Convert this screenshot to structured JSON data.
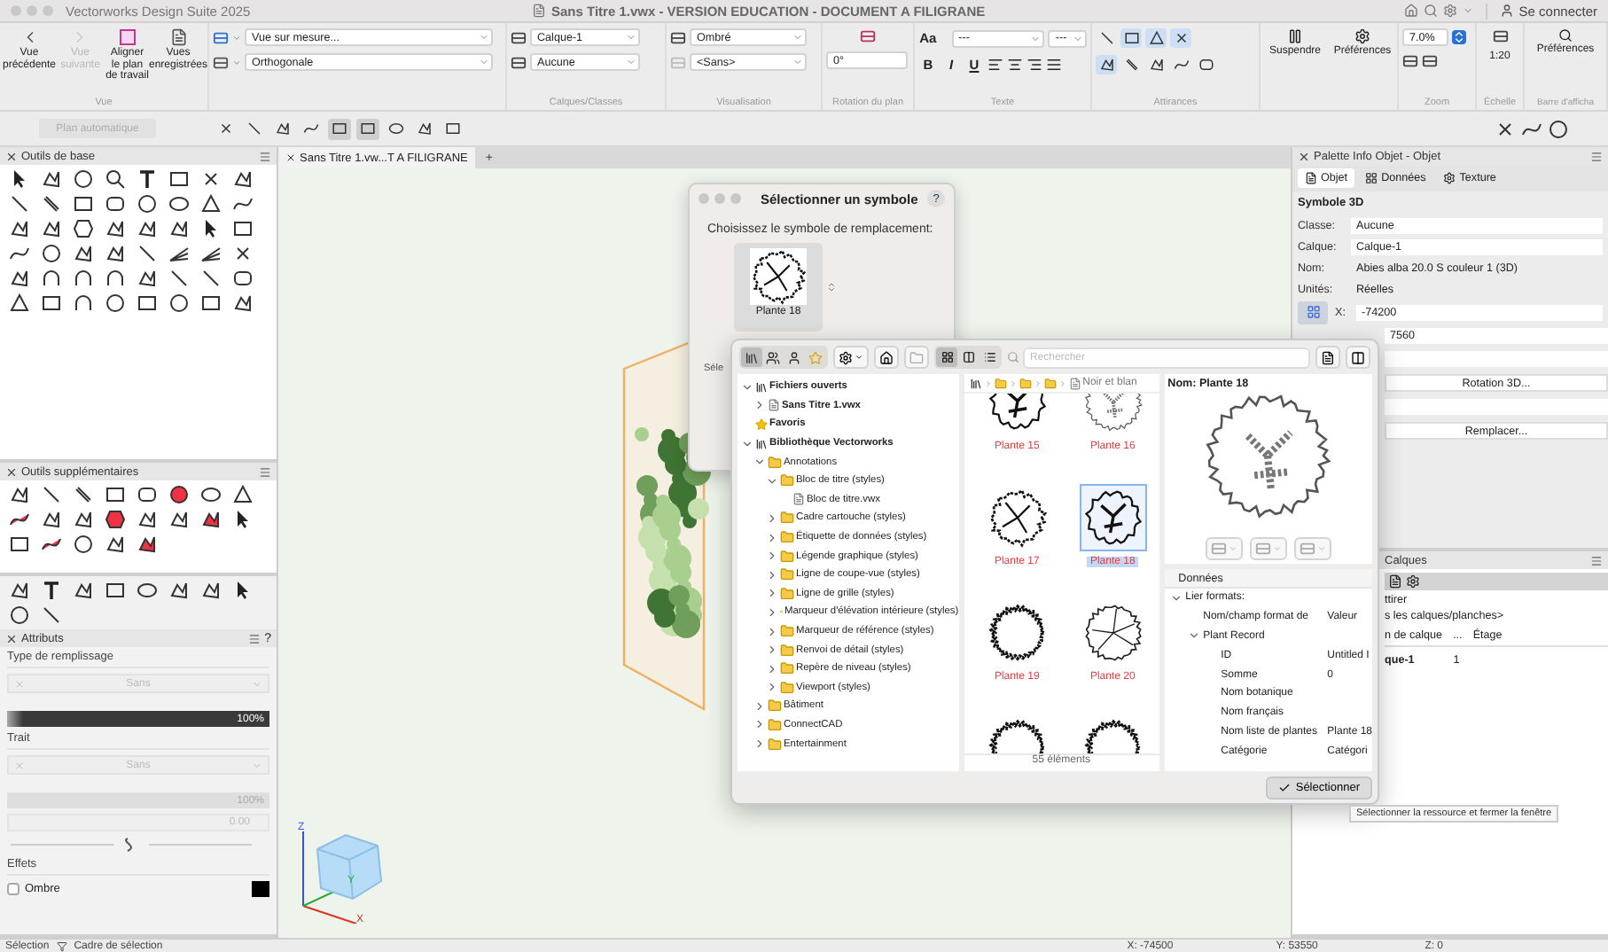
{
  "window": {
    "app": "Vectorworks Design Suite 2025",
    "title": "Sans Titre 1.vwx - VERSION EDUCATION - DOCUMENT A FILIGRANE",
    "account": "Se connecter"
  },
  "toolbar": {
    "view": {
      "buttons": [
        {
          "label": "Vue précédente",
          "disabled": false
        },
        {
          "label": "Vue suivante",
          "disabled": true
        },
        {
          "label": "Aligner le plan de travail",
          "disabled": false
        },
        {
          "label": "Vues enregistrées",
          "disabled": false
        }
      ],
      "group_label": "Vue"
    },
    "view_selects": [
      "Vue sur mesure...",
      "Orthogonale"
    ],
    "layers": {
      "selects": [
        "Calque-1",
        "Aucune"
      ],
      "group_label": "Calques/Classes"
    },
    "render": {
      "selects": [
        "Ombré",
        "<Sans>"
      ],
      "group_label": "Visualisation"
    },
    "plane_rotation": {
      "value": "0°",
      "group_label": "Rotation du plan"
    },
    "text": {
      "size_button": "Aa",
      "font": "---",
      "size": "---",
      "styles": [
        "B",
        "I",
        "U"
      ],
      "group_label": "Texte"
    },
    "snapping": {
      "buttons": [
        {
          "on": false
        },
        {
          "on": true
        },
        {
          "on": true
        },
        {
          "on": true
        },
        {
          "on": true
        },
        {
          "on": false
        },
        {
          "on": false
        },
        {
          "on": false
        },
        {
          "on": false
        }
      ],
      "group_label": "Attirances"
    },
    "suspend": "Suspendre",
    "preferences": "Préférences",
    "zoom": {
      "value": "7.0%",
      "group_label": "Zoom"
    },
    "scale": {
      "value": "1:20",
      "group_label": "Échelle"
    },
    "display_bar": {
      "button": "Préférences",
      "group_label": "Barre d'afficha"
    }
  },
  "toolbar2": {
    "auto_plane": {
      "label": "Plan automatique",
      "disabled": true
    },
    "mode_buttons": [
      {
        "on": false
      },
      {
        "on": false
      },
      {
        "on": false
      },
      {
        "on": false
      },
      {
        "on": true
      },
      {
        "on": true
      },
      {
        "on": false
      },
      {
        "on": false
      },
      {
        "on": false
      }
    ]
  },
  "basic_tools": {
    "title": "Outils de base"
  },
  "extra_tools": {
    "title": "Outils supplémentaires"
  },
  "attributes": {
    "title": "Attributs",
    "help": "?",
    "fill_label": "Type de remplissage",
    "fill": "Sans",
    "fill_opacity": "100%",
    "pen_label": "Trait",
    "pen": "Sans",
    "pen_opacity": "100%",
    "thickness": "0.00",
    "effects_label": "Effets",
    "shadow": {
      "label": "Ombre",
      "checked": false
    }
  },
  "document_tabs": [
    {
      "label": "Sans Titre 1.vw...T A FILIGRANE",
      "selected": true
    }
  ],
  "new_tab": "+",
  "view_cube": {
    "axes": [
      "Z",
      "Y",
      "X"
    ]
  },
  "info_palette": {
    "title": "Palette Info Objet - Objet",
    "tabs": [
      {
        "label": "Objet",
        "selected": true
      },
      {
        "label": "Données",
        "selected": false
      },
      {
        "label": "Texture",
        "selected": false
      }
    ],
    "object_type": "Symbole 3D",
    "fields": [
      {
        "label": "Classe:",
        "value": "Aucune",
        "kind": "field"
      },
      {
        "label": "Calque:",
        "value": "Calque-1",
        "kind": "field"
      },
      {
        "label": "Nom:",
        "value": "Abies alba 20.0 S couleur 1 (3D)",
        "kind": "text"
      },
      {
        "label": "Unités:",
        "value": "Réelles",
        "kind": "text"
      }
    ],
    "x": {
      "label": "X:",
      "value": "-74200"
    },
    "y_value": "7560",
    "buttons": [
      "Rotation 3D...",
      "Remplacer..."
    ]
  },
  "layers_palette": {
    "title": "Calques",
    "snap_option": "ttirer",
    "filter": "s les calques/planches>",
    "columns": [
      "n de calque",
      "...",
      "Étage"
    ],
    "rows": [
      {
        "cells": [
          "que-1",
          "1"
        ]
      }
    ]
  },
  "symbol_dialog": {
    "title": "Sélectionner un symbole",
    "help": "?",
    "prompt": "Choisissez le symbole de remplacement:",
    "symbol": "Plante 18",
    "cut_label": "Séle"
  },
  "resource_browser": {
    "library_tabs": [
      {
        "selected": true
      },
      {
        "selected": false
      },
      {
        "selected": false
      },
      {
        "selected": false
      }
    ],
    "view_modes": [
      {
        "selected": true
      },
      {
        "selected": false
      },
      {
        "selected": false
      }
    ],
    "search_placeholder": "Rechercher",
    "breadcrumb": "Noir et blan",
    "tree": [
      {
        "label": "Fichiers ouverts",
        "kind": "library",
        "expanded": true,
        "children": [
          {
            "label": "Sans Titre 1.vwx",
            "kind": "file",
            "expanded": false
          }
        ]
      },
      {
        "label": "Favoris",
        "kind": "favorites"
      },
      {
        "label": "Bibliothèque Vectorworks",
        "kind": "library",
        "expanded": true,
        "children": [
          {
            "label": "Annotations",
            "kind": "folder",
            "expanded": true,
            "children": [
              {
                "label": "Bloc de titre (styles)",
                "kind": "folder",
                "expanded": true,
                "children": [
                  {
                    "label": "Bloc de titre.vwx",
                    "kind": "file"
                  }
                ]
              },
              {
                "label": "Cadre cartouche (styles)",
                "kind": "folder",
                "expanded": false
              },
              {
                "label": "Étiquette de données (styles)",
                "kind": "folder",
                "expanded": false
              },
              {
                "label": "Légende graphique (styles)",
                "kind": "folder",
                "expanded": false
              },
              {
                "label": "Ligne de coupe-vue (styles)",
                "kind": "folder",
                "expanded": false
              },
              {
                "label": "Ligne de grille (styles)",
                "kind": "folder",
                "expanded": false
              },
              {
                "label": "Marqueur d'élévation intérieure (styles)",
                "kind": "folder",
                "expanded": false
              },
              {
                "label": "Marqueur de référence (styles)",
                "kind": "folder",
                "expanded": false
              },
              {
                "label": "Renvoi de détail (styles)",
                "kind": "folder",
                "expanded": false
              },
              {
                "label": "Repère de niveau (styles)",
                "kind": "folder",
                "expanded": false
              },
              {
                "label": "Viewport (styles)",
                "kind": "folder",
                "expanded": false
              }
            ]
          },
          {
            "label": "Bâtiment",
            "kind": "folder",
            "expanded": false
          },
          {
            "label": "ConnectCAD",
            "kind": "folder",
            "expanded": false
          },
          {
            "label": "Entertainment",
            "kind": "folder",
            "expanded": false
          }
        ]
      }
    ],
    "items": [
      {
        "label": "Plante 15",
        "selected": false
      },
      {
        "label": "Plante 16",
        "selected": false
      },
      {
        "label": "Plante 17",
        "selected": false
      },
      {
        "label": "Plante 18",
        "selected": true
      },
      {
        "label": "Plante 19",
        "selected": false
      },
      {
        "label": "Plante 20",
        "selected": false
      }
    ],
    "count": "55 éléments",
    "preview_name": "Nom: Plante 18",
    "data_tab": "Données",
    "data": [
      {
        "label": "Lier formats:",
        "expanded": true,
        "children": [
          {
            "label": "Nom/champ format de",
            "value": "Valeur"
          },
          {
            "label": "Plant Record",
            "expanded": true,
            "children": [
              {
                "label": "ID",
                "value": "Untitled I"
              },
              {
                "label": "Somme",
                "value": "0"
              },
              {
                "label": "Nom botanique"
              },
              {
                "label": "Nom français"
              },
              {
                "label": "Nom liste de plantes",
                "value": "Plante 18"
              },
              {
                "label": "Catégorie",
                "value": "Catégori"
              }
            ]
          }
        ]
      }
    ],
    "select_button": "Sélectionner",
    "tooltip": "Sélectionner la ressource et fermer la fenêtre"
  },
  "status": {
    "mode": "Sélection",
    "submode": "Cadre de sélection",
    "x": "X: -74500",
    "y": "Y: 53550",
    "z": "Z: 0"
  }
}
